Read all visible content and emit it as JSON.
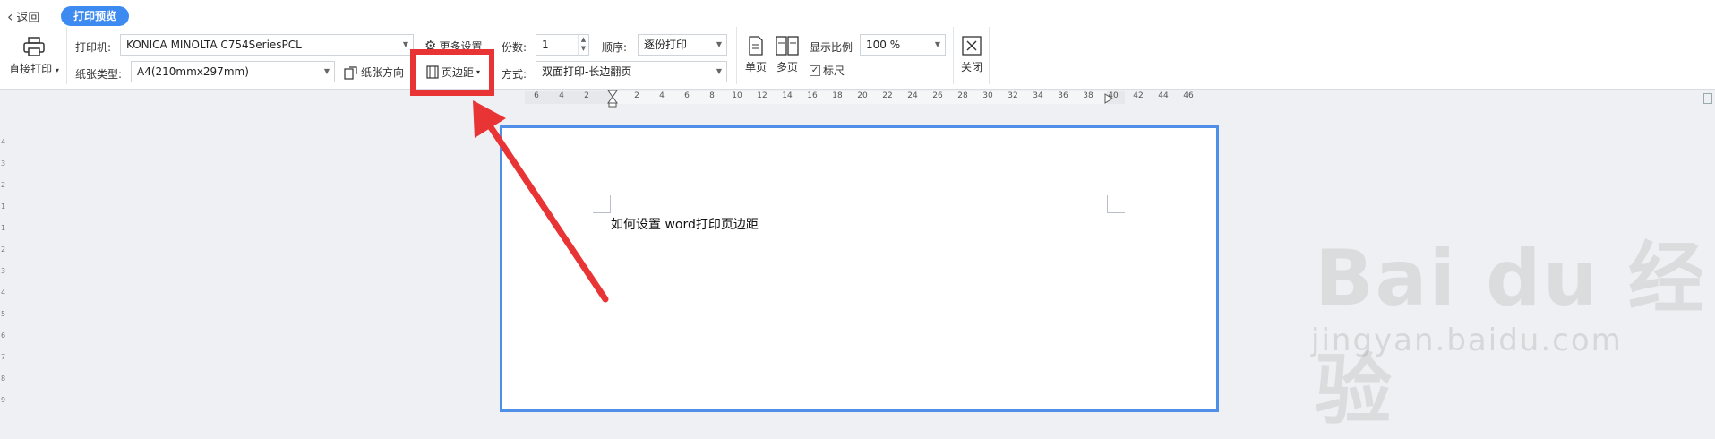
{
  "header": {
    "back_label": "返回",
    "mode_label": "打印预览"
  },
  "toolbar": {
    "direct_print": "直接打印",
    "printer_label": "打印机:",
    "printer_value": "KONICA MINOLTA C754SeriesPCL",
    "more_settings": "更多设置",
    "paper_type_label": "纸张类型:",
    "paper_type_value": "A4(210mmx297mm)",
    "paper_orientation": "纸张方向",
    "margins": "页边距",
    "copies_label": "份数:",
    "copies_value": "1",
    "order_label": "顺序:",
    "order_value": "逐份打印",
    "method_label": "方式:",
    "method_value": "双面打印-长边翻页",
    "single_page": "单页",
    "multi_page": "多页",
    "zoom_label": "显示比例",
    "zoom_value": "100 %",
    "ruler_checkbox": "标尺",
    "close": "关闭"
  },
  "ruler": {
    "top_ticks": [
      "6",
      "4",
      "2",
      "2",
      "4",
      "6",
      "8",
      "10",
      "12",
      "14",
      "16",
      "18",
      "20",
      "22",
      "24",
      "26",
      "28",
      "30",
      "32",
      "34",
      "36",
      "38",
      "40",
      "42",
      "44",
      "46"
    ],
    "left_ticks": [
      "4",
      "3",
      "2",
      "1",
      "1",
      "2",
      "3",
      "4",
      "5",
      "6",
      "7",
      "8",
      "9"
    ]
  },
  "document": {
    "text": "如何设置 word打印页边距"
  },
  "watermark": {
    "brand": "Bai du 经验",
    "url": "jingyan.baidu.com"
  },
  "colors": {
    "accent": "#3d8bf0",
    "highlight": "#e83434",
    "page_border": "#4f8fe8"
  }
}
